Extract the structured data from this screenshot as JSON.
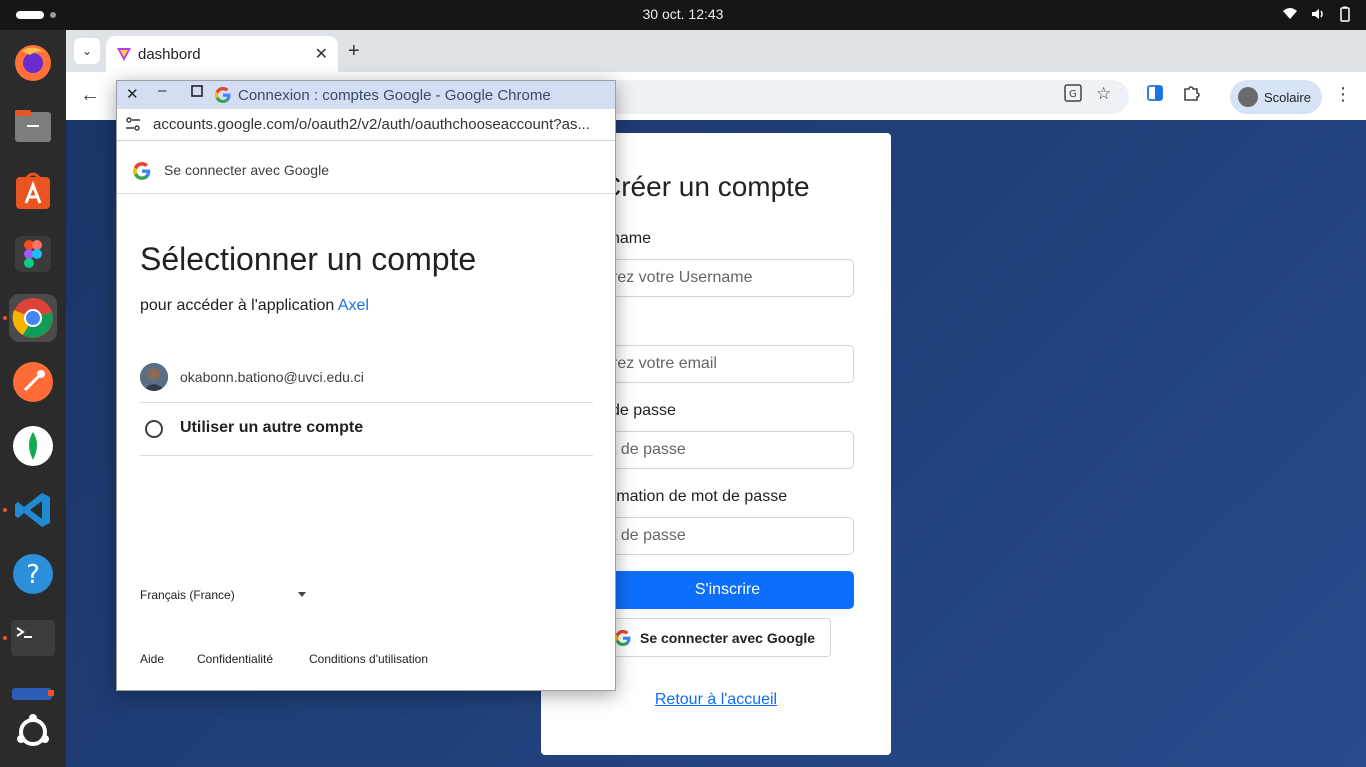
{
  "system": {
    "clock": "30 oct.  12:43"
  },
  "browser": {
    "tab_title": "dashbord",
    "profile_name": "Scolaire"
  },
  "popup": {
    "window_title": "Connexion : comptes Google - Google Chrome",
    "url": "accounts.google.com/o/oauth2/v2/auth/oauthchooseaccount?as...",
    "header": "Se connecter avec Google",
    "heading": "Sélectionner un compte",
    "subtitle_prefix": "pour accéder à l'application",
    "app_name": "Axel",
    "account_email": "okabonn.bationo@uvci.edu.ci",
    "other_account": "Utiliser un autre compte",
    "language": "Français (France)",
    "footer": {
      "help": "Aide",
      "privacy": "Confidentialité",
      "terms": "Conditions d'utilisation"
    }
  },
  "form": {
    "title": "Créer un compte",
    "username_label": "name",
    "username_placeholder": "rez votre Username",
    "email_label": "l",
    "email_placeholder": "rez votre email",
    "password_label": "de passe",
    "password_placeholder": "t de passe",
    "confirm_label": "rmation de mot de passe",
    "confirm_placeholder": "t de passe",
    "submit": "S'inscrire",
    "google_button": "Se connecter avec Google",
    "back_link": "Retour à l'accueil"
  },
  "colors": {
    "primary": "#0d6efd",
    "google_link": "#1a73e8",
    "page_bg": "#1d3a72"
  }
}
